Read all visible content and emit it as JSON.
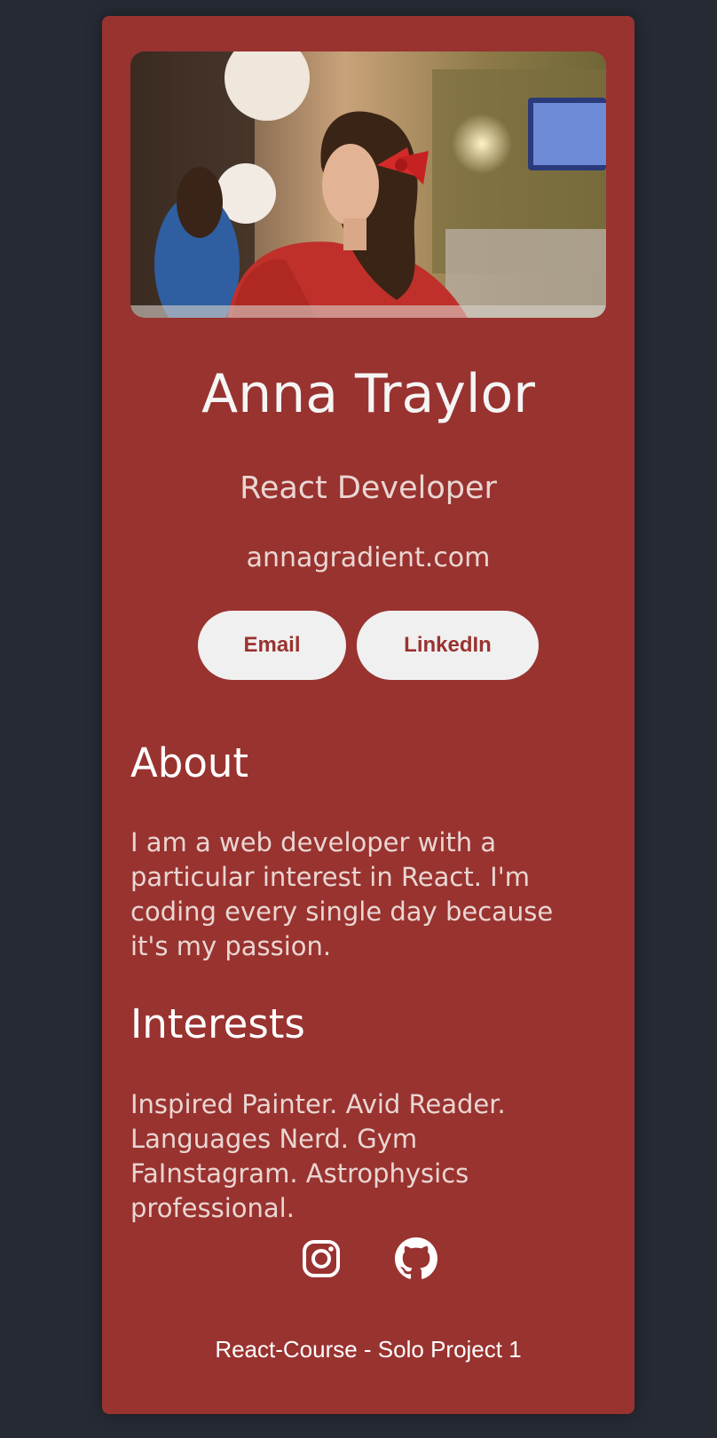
{
  "profile": {
    "name": "Anna Traylor",
    "role": "React Developer",
    "website": "annagradient.com"
  },
  "buttons": {
    "email": "Email",
    "linkedin": "LinkedIn"
  },
  "about": {
    "title": "About",
    "body": "I am a web developer with a particular interest in React. I'm coding every single day because it's my passion."
  },
  "interests": {
    "title": "Interests",
    "body": "Inspired Painter. Avid Reader. Languages Nerd. Gym FaInstagram. Astrophysics professional."
  },
  "social": {
    "icons": [
      "instagram-icon",
      "github-icon"
    ]
  },
  "footer": {
    "text": "React-Course - Solo Project 1"
  },
  "colors": {
    "page_background": "#262a33",
    "card_background": "#993330",
    "button_background": "#f1f0f0",
    "button_text": "#993330",
    "heading_text": "#ffffff",
    "body_text": "#ead6d2"
  }
}
